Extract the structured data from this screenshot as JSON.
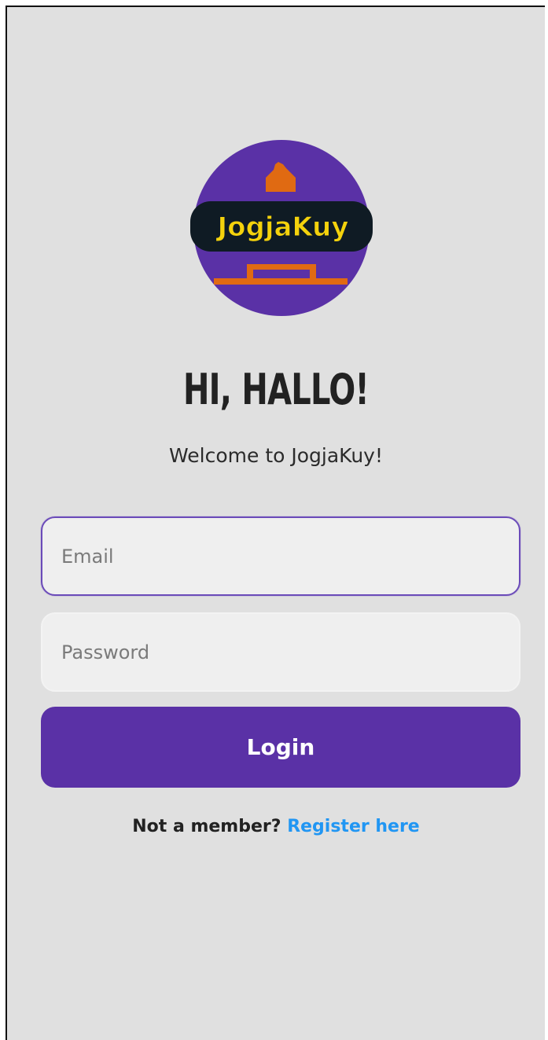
{
  "logo": {
    "text": "JogjaKuy",
    "circle_color": "#5a31a6",
    "band_color": "#0f1b24",
    "text_color": "#f4d20c",
    "monument_color": "#e06a12"
  },
  "heading": {
    "title": "HI, HALLO!",
    "subtitle": "Welcome to JogjaKuy!"
  },
  "form": {
    "email_placeholder": "Email",
    "email_value": "",
    "password_placeholder": "Password",
    "password_value": "",
    "login_label": "Login"
  },
  "footer": {
    "prompt": "Not a member?",
    "register_label": "Register here"
  },
  "colors": {
    "background": "#e0e0e0",
    "accent": "#5a31a6",
    "link": "#2196f3"
  }
}
